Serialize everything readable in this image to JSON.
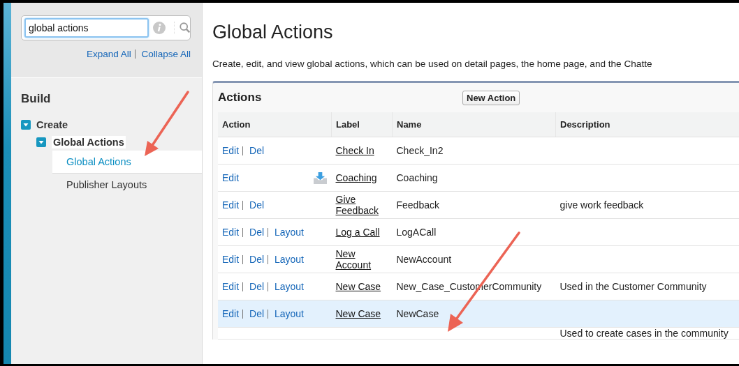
{
  "sidebar": {
    "search": {
      "value": "global actions"
    },
    "links": [
      "Expand All",
      "Collapse All"
    ],
    "section_title": "Build",
    "tree": [
      {
        "label": "Create",
        "expanded": true,
        "selected": false,
        "children": [
          {
            "label": "Global Actions",
            "expanded": true,
            "selected": false,
            "children": [
              {
                "label": "Global Actions",
                "selected": true
              },
              {
                "label": "Publisher Layouts",
                "selected": false
              }
            ]
          }
        ]
      }
    ]
  },
  "page": {
    "title": "Global Actions",
    "description": "Create, edit, and view global actions, which can be used on detail pages, the home page, and the Chatte"
  },
  "panel": {
    "title": "Actions",
    "button": "New Action",
    "table": {
      "columns": [
        "Action",
        "Label",
        "Name",
        "Description"
      ],
      "rows": [
        {
          "actions": [
            "Edit",
            "Del"
          ],
          "has_icon": false,
          "label": "Check In",
          "name": "Check_In2",
          "description": "",
          "selected": false
        },
        {
          "actions": [
            "Edit"
          ],
          "has_icon": true,
          "label": "Coaching",
          "name": "Coaching",
          "description": "",
          "selected": false
        },
        {
          "actions": [
            "Edit",
            "Del"
          ],
          "has_icon": false,
          "label": "Give Feedback",
          "name": "Feedback",
          "description": "give work feedback",
          "selected": false
        },
        {
          "actions": [
            "Edit",
            "Del",
            "Layout"
          ],
          "has_icon": false,
          "label": "Log a Call",
          "name": "LogACall",
          "description": "",
          "selected": false
        },
        {
          "actions": [
            "Edit",
            "Del",
            "Layout"
          ],
          "has_icon": false,
          "label": "New Account",
          "name": "NewAccount",
          "description": "",
          "selected": false
        },
        {
          "actions": [
            "Edit",
            "Del",
            "Layout"
          ],
          "has_icon": false,
          "label": "New Case",
          "name": "New_Case_CustomerCommunity",
          "description": "Used in the Customer Community",
          "selected": false
        },
        {
          "actions": [
            "Edit",
            "Del",
            "Layout"
          ],
          "has_icon": false,
          "label": "New Case",
          "name": "NewCase",
          "description": "",
          "selected": true
        },
        {
          "actions": [],
          "has_icon": false,
          "label": "",
          "name": "",
          "description": "Used to create cases in the community",
          "selected": false
        }
      ]
    }
  }
}
